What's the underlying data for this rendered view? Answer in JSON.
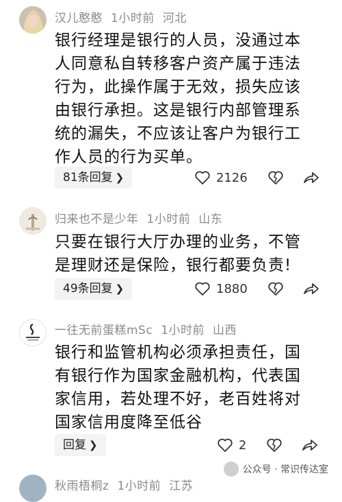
{
  "comments": [
    {
      "username": "汉儿憨憨",
      "time": "1小时前",
      "location": "河北",
      "lines": [
        "银行经理是银行的人员，没通过本",
        "人同意私自转移客户资产属于违法",
        "行为，此操作属于无效，损失应该",
        "由银行承担。这是银行内部管理系",
        "统的漏失，不应该让客户为银行工",
        "作人员的行为买单。"
      ],
      "reply_label": "81条回复",
      "like_count": "2126"
    },
    {
      "username": "归来也不是少年",
      "time": "1小时前",
      "location": "山东",
      "lines": [
        "只要在银行大厅办理的业务，不管",
        "是理财还是保险，银行都要负责!"
      ],
      "reply_label": "49条回复",
      "like_count": "1880"
    },
    {
      "username": "一往无前蛋糕mSc",
      "time": "1小时前",
      "location": "山西",
      "lines": [
        "银行和监管机构必须承担责任，国",
        "有银行作为国家金融机构，代表国",
        "家信用，若处理不好，老百姓将对",
        "国家信用度降至低谷"
      ],
      "reply_label": "回复",
      "like_count": "2"
    },
    {
      "username": "秋雨梧桐z",
      "time": "1小时前",
      "location": "江苏"
    }
  ],
  "watermark": "公众号 · 常识传达室",
  "colors": {
    "meta": "#8a8a8a",
    "button_bg": "#f3f3f3",
    "icon": "#333333"
  }
}
